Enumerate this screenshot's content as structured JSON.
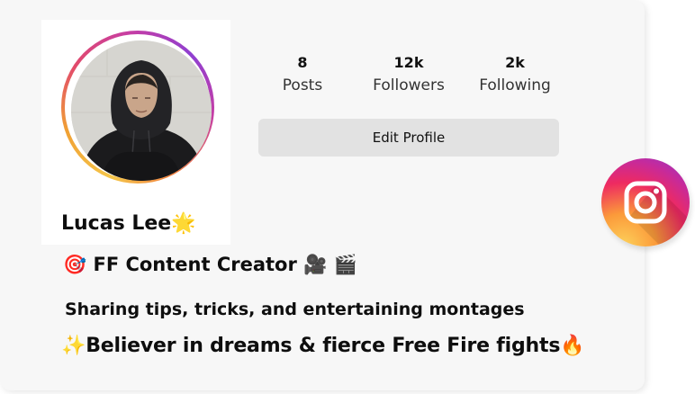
{
  "profile": {
    "name": "Lucas Lee",
    "name_emoji": "🌟",
    "avatar_icon": "person-hoodie-photo",
    "edit_button_label": "Edit Profile"
  },
  "stats": [
    {
      "value": "8",
      "label": "Posts"
    },
    {
      "value": "12k",
      "label": "Followers"
    },
    {
      "value": "2k",
      "label": "Following"
    }
  ],
  "bio": {
    "title_prefix_emoji": "🎯",
    "title": "FF Content Creator",
    "title_suffix_emoji_1": "🎥",
    "title_suffix_emoji_2": "🎬",
    "tagline": "Sharing tips, tricks, and entertaining montages",
    "belief_prefix_emoji": "✨",
    "belief": "Believer in dreams & fierce Free Fire fights",
    "belief_suffix_emoji": "🔥"
  },
  "badge": {
    "icon": "instagram-icon"
  },
  "colors": {
    "card_bg": "#f7f7f7",
    "button_bg": "#e2e2e2",
    "ring_gradient": [
      "#f5c64a",
      "#e24a6b",
      "#8f3fd1"
    ],
    "instagram_gradient": [
      "#fdd25b",
      "#ee2a61",
      "#8a38d1"
    ]
  }
}
